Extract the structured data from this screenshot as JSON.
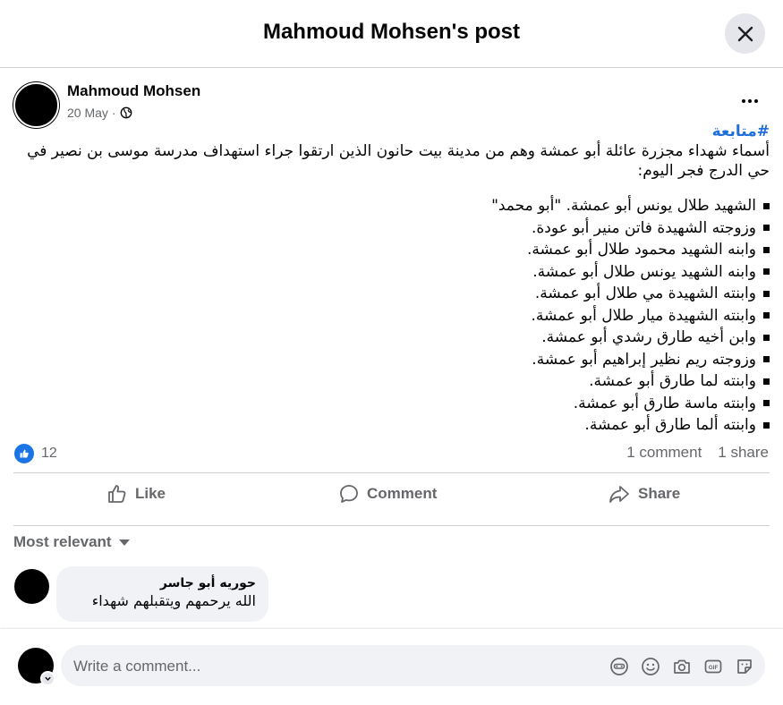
{
  "header": {
    "title": "Mahmoud Mohsen's post"
  },
  "post": {
    "author": "Mahmoud Mohsen",
    "date": "20 May",
    "date_separator": "·",
    "hashtag": "#متابعة",
    "text": "أسماء شهداء مجزرة عائلة أبو عمشة وهم من مدينة بيت حانون الذين ارتقوا جراء استهداف مدرسة موسى بن نصير في حي الدرج فجر اليوم:",
    "list": [
      "الشهيد طلال يونس أبو عمشة. \"أبو محمد\"",
      "وزوجته الشهيدة فاتن منير أبو عودة.",
      "وابنه الشهيد محمود طلال أبو عمشة.",
      "وابنه الشهيد يونس طلال أبو عمشة.",
      "وابنته الشهيدة مي طلال أبو عمشة.",
      "وابنته الشهيدة ميار طلال أبو عمشة.",
      "وابن أخيه طارق رشدي أبو عمشة.",
      "وزوجته ريم نظير إبراهيم أبو عمشة.",
      "وابنته لما طارق أبو عمشة.",
      "وابنته ماسة طارق أبو عمشة.",
      "وابنته ألما طارق أبو عمشة."
    ]
  },
  "stats": {
    "likes": "12",
    "comments": "1 comment",
    "shares": "1 share"
  },
  "actions": {
    "like": "Like",
    "comment": "Comment",
    "share": "Share"
  },
  "filter": {
    "label": "Most relevant"
  },
  "comments": [
    {
      "name": "حوريه أبو جاسر",
      "text": "الله يرحمهم ويتقبلهم شهداء"
    }
  ],
  "composer": {
    "placeholder": "Write a comment..."
  },
  "colors": {
    "accent": "#1b74e4",
    "hashtag": "#216fdb",
    "bubble": "#f0f2f5",
    "muted": "#65676b"
  },
  "icons": [
    "close-icon",
    "globe-icon",
    "more-icon",
    "like-reaction-icon",
    "thumbs-up-icon",
    "comment-icon",
    "share-icon",
    "caret-down-icon",
    "chevron-down-icon",
    "avatar-icon",
    "emoji-icon",
    "camera-icon",
    "gif-icon",
    "sticker-icon"
  ]
}
